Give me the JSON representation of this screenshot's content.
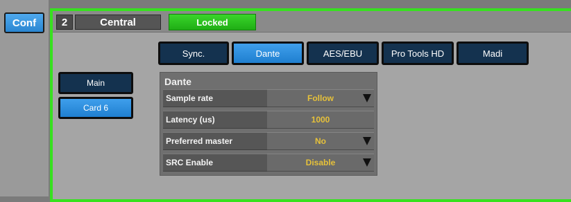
{
  "left_rail": {
    "conf_label": "Conf"
  },
  "header": {
    "index": "2",
    "name": "Central",
    "status": "Locked",
    "status_color": "#2ccc1e",
    "frame_color": "#37e11f"
  },
  "tabs": [
    {
      "label": "Sync.",
      "active": false
    },
    {
      "label": "Dante",
      "active": true
    },
    {
      "label": "AES/EBU",
      "active": false
    },
    {
      "label": "Pro Tools HD",
      "active": false
    },
    {
      "label": "Madi",
      "active": false
    }
  ],
  "side_buttons": [
    {
      "label": "Main",
      "active": false
    },
    {
      "label": "Card 6",
      "active": true
    }
  ],
  "panel": {
    "title": "Dante",
    "rows": [
      {
        "label": "Sample rate",
        "value": "Follow",
        "dropdown": true
      },
      {
        "label": "Latency (us)",
        "value": "1000",
        "dropdown": false
      },
      {
        "label": "Preferred master",
        "value": "No",
        "dropdown": true
      },
      {
        "label": "SRC Enable",
        "value": "Disable",
        "dropdown": true
      }
    ]
  },
  "colors": {
    "accent_blue": "#2a86d1",
    "dark_button": "#14324f",
    "value_text": "#e6c13a"
  }
}
